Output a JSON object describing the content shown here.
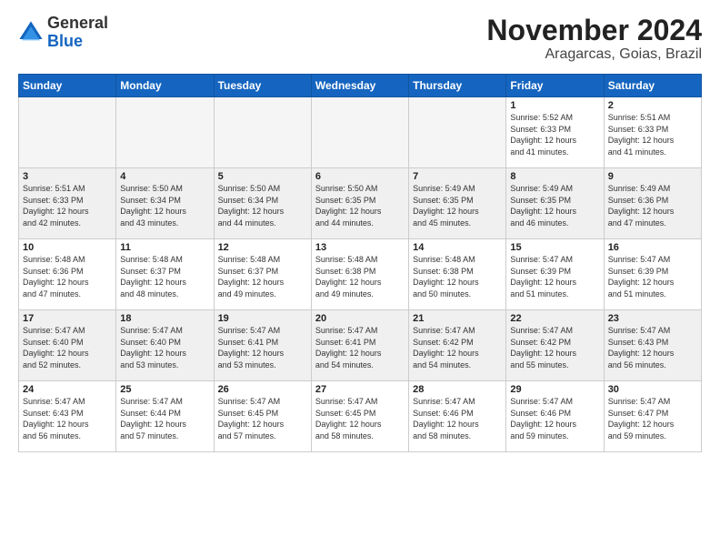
{
  "logo": {
    "general": "General",
    "blue": "Blue"
  },
  "header": {
    "month": "November 2024",
    "location": "Aragarcas, Goias, Brazil"
  },
  "weekdays": [
    "Sunday",
    "Monday",
    "Tuesday",
    "Wednesday",
    "Thursday",
    "Friday",
    "Saturday"
  ],
  "weeks": [
    [
      {
        "day": "",
        "info": ""
      },
      {
        "day": "",
        "info": ""
      },
      {
        "day": "",
        "info": ""
      },
      {
        "day": "",
        "info": ""
      },
      {
        "day": "",
        "info": ""
      },
      {
        "day": "1",
        "info": "Sunrise: 5:52 AM\nSunset: 6:33 PM\nDaylight: 12 hours\nand 41 minutes."
      },
      {
        "day": "2",
        "info": "Sunrise: 5:51 AM\nSunset: 6:33 PM\nDaylight: 12 hours\nand 41 minutes."
      }
    ],
    [
      {
        "day": "3",
        "info": "Sunrise: 5:51 AM\nSunset: 6:33 PM\nDaylight: 12 hours\nand 42 minutes."
      },
      {
        "day": "4",
        "info": "Sunrise: 5:50 AM\nSunset: 6:34 PM\nDaylight: 12 hours\nand 43 minutes."
      },
      {
        "day": "5",
        "info": "Sunrise: 5:50 AM\nSunset: 6:34 PM\nDaylight: 12 hours\nand 44 minutes."
      },
      {
        "day": "6",
        "info": "Sunrise: 5:50 AM\nSunset: 6:35 PM\nDaylight: 12 hours\nand 44 minutes."
      },
      {
        "day": "7",
        "info": "Sunrise: 5:49 AM\nSunset: 6:35 PM\nDaylight: 12 hours\nand 45 minutes."
      },
      {
        "day": "8",
        "info": "Sunrise: 5:49 AM\nSunset: 6:35 PM\nDaylight: 12 hours\nand 46 minutes."
      },
      {
        "day": "9",
        "info": "Sunrise: 5:49 AM\nSunset: 6:36 PM\nDaylight: 12 hours\nand 47 minutes."
      }
    ],
    [
      {
        "day": "10",
        "info": "Sunrise: 5:48 AM\nSunset: 6:36 PM\nDaylight: 12 hours\nand 47 minutes."
      },
      {
        "day": "11",
        "info": "Sunrise: 5:48 AM\nSunset: 6:37 PM\nDaylight: 12 hours\nand 48 minutes."
      },
      {
        "day": "12",
        "info": "Sunrise: 5:48 AM\nSunset: 6:37 PM\nDaylight: 12 hours\nand 49 minutes."
      },
      {
        "day": "13",
        "info": "Sunrise: 5:48 AM\nSunset: 6:38 PM\nDaylight: 12 hours\nand 49 minutes."
      },
      {
        "day": "14",
        "info": "Sunrise: 5:48 AM\nSunset: 6:38 PM\nDaylight: 12 hours\nand 50 minutes."
      },
      {
        "day": "15",
        "info": "Sunrise: 5:47 AM\nSunset: 6:39 PM\nDaylight: 12 hours\nand 51 minutes."
      },
      {
        "day": "16",
        "info": "Sunrise: 5:47 AM\nSunset: 6:39 PM\nDaylight: 12 hours\nand 51 minutes."
      }
    ],
    [
      {
        "day": "17",
        "info": "Sunrise: 5:47 AM\nSunset: 6:40 PM\nDaylight: 12 hours\nand 52 minutes."
      },
      {
        "day": "18",
        "info": "Sunrise: 5:47 AM\nSunset: 6:40 PM\nDaylight: 12 hours\nand 53 minutes."
      },
      {
        "day": "19",
        "info": "Sunrise: 5:47 AM\nSunset: 6:41 PM\nDaylight: 12 hours\nand 53 minutes."
      },
      {
        "day": "20",
        "info": "Sunrise: 5:47 AM\nSunset: 6:41 PM\nDaylight: 12 hours\nand 54 minutes."
      },
      {
        "day": "21",
        "info": "Sunrise: 5:47 AM\nSunset: 6:42 PM\nDaylight: 12 hours\nand 54 minutes."
      },
      {
        "day": "22",
        "info": "Sunrise: 5:47 AM\nSunset: 6:42 PM\nDaylight: 12 hours\nand 55 minutes."
      },
      {
        "day": "23",
        "info": "Sunrise: 5:47 AM\nSunset: 6:43 PM\nDaylight: 12 hours\nand 56 minutes."
      }
    ],
    [
      {
        "day": "24",
        "info": "Sunrise: 5:47 AM\nSunset: 6:43 PM\nDaylight: 12 hours\nand 56 minutes."
      },
      {
        "day": "25",
        "info": "Sunrise: 5:47 AM\nSunset: 6:44 PM\nDaylight: 12 hours\nand 57 minutes."
      },
      {
        "day": "26",
        "info": "Sunrise: 5:47 AM\nSunset: 6:45 PM\nDaylight: 12 hours\nand 57 minutes."
      },
      {
        "day": "27",
        "info": "Sunrise: 5:47 AM\nSunset: 6:45 PM\nDaylight: 12 hours\nand 58 minutes."
      },
      {
        "day": "28",
        "info": "Sunrise: 5:47 AM\nSunset: 6:46 PM\nDaylight: 12 hours\nand 58 minutes."
      },
      {
        "day": "29",
        "info": "Sunrise: 5:47 AM\nSunset: 6:46 PM\nDaylight: 12 hours\nand 59 minutes."
      },
      {
        "day": "30",
        "info": "Sunrise: 5:47 AM\nSunset: 6:47 PM\nDaylight: 12 hours\nand 59 minutes."
      }
    ]
  ]
}
